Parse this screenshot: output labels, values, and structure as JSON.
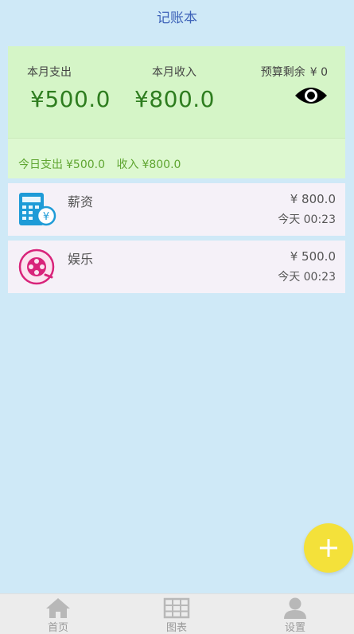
{
  "app": {
    "title": "记账本"
  },
  "summary": {
    "month_expense_label": "本月支出",
    "month_income_label": "本月收入",
    "budget_label": "预算剩余",
    "budget_value": "¥ 0",
    "month_expense": "¥500.0",
    "month_income": "¥800.0",
    "visibility_icon": "eye-icon",
    "today_expense_label": "今日支出",
    "today_expense": "¥500.0",
    "today_income_label": "收入",
    "today_income": "¥800.0"
  },
  "records": [
    {
      "name": "薪资",
      "amount": "¥ 800.0",
      "time": "今天 00:23",
      "icon": "salary-calculator-icon"
    },
    {
      "name": "娱乐",
      "amount": "¥ 500.0",
      "time": "今天 00:23",
      "icon": "entertainment-film-reel-icon"
    }
  ],
  "fab": {
    "icon": "plus-icon"
  },
  "tabbar": {
    "items": [
      {
        "label": "首页",
        "icon": "home-icon"
      },
      {
        "label": "图表",
        "icon": "grid-chart-icon"
      },
      {
        "label": "设置",
        "icon": "user-icon"
      }
    ]
  },
  "colors": {
    "background": "#cfe9f7",
    "title": "#3d62b8",
    "summary_bg": "#d5f5c7",
    "amount_green": "#2e7d1f",
    "today_green": "#5fa531",
    "record_bg": "#f5f1f8",
    "fab": "#f4e13a"
  }
}
